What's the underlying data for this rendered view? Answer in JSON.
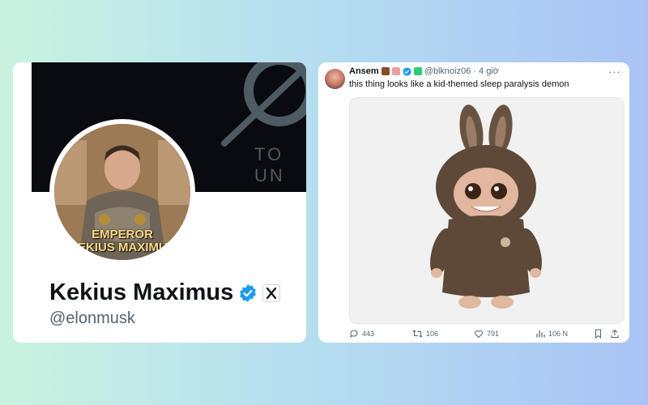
{
  "profile": {
    "banner_text": "TO UN",
    "avatar_caption_line1": "EMPEROR",
    "avatar_caption_line2": "KEKIUS MAXIMUS",
    "name": "Kekius Maximus",
    "handle": "@elonmusk",
    "verified_color": "#1d9bf0",
    "badge_icon": "x-logo-icon"
  },
  "tweet": {
    "author": "Ansem",
    "handle": "@blknoiz06",
    "separator": "·",
    "time": "4 giờ",
    "more": "···",
    "text": "this thing looks like a kid-themed sleep paralysis demon",
    "media_description": "brown furry doll",
    "actions": {
      "replies": "443",
      "reposts": "106",
      "likes": "791",
      "views": "106 N"
    }
  },
  "colors": {
    "background_left": "#c9f3df",
    "background_right": "#a9c3f5",
    "accent": "#1d9bf0",
    "text_primary": "#0f1419",
    "text_secondary": "#536471"
  }
}
